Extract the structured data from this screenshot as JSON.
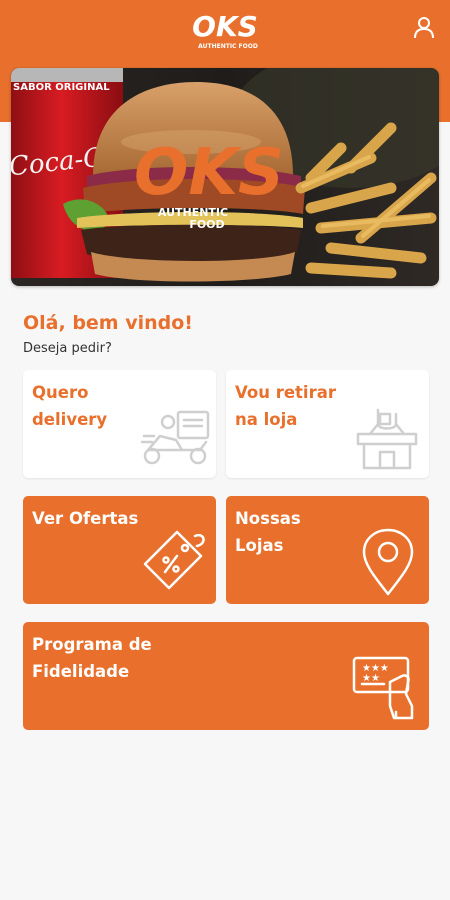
{
  "header": {
    "logo_text": "OKS",
    "logo_subtext": "AUTHENTIC FOOD",
    "accent_color": "#e8702c",
    "profile_icon": "user-icon"
  },
  "hero": {
    "logo_text": "OKS",
    "tagline_line1": "AUTHENTIC",
    "tagline_line2": "FOOD",
    "can_brand": "Coca-Cola",
    "can_label": "SABOR ORIGINAL"
  },
  "greeting": {
    "title": "Olá, bem vindo!",
    "subtitle": "Deseja pedir?"
  },
  "options": {
    "delivery": {
      "line1": "Quero",
      "line2": "delivery",
      "icon": "delivery-scooter-icon"
    },
    "pickup": {
      "line1": "Vou retirar",
      "line2": "na loja",
      "icon": "store-pickup-icon"
    },
    "offers": {
      "line1": "Ver Ofertas",
      "icon": "discount-tag-icon"
    },
    "stores": {
      "line1": "Nossas",
      "line2": "Lojas",
      "icon": "location-pin-icon"
    },
    "loyalty": {
      "line1": "Programa de",
      "line2": "Fidelidade",
      "icon": "loyalty-card-icon"
    }
  }
}
